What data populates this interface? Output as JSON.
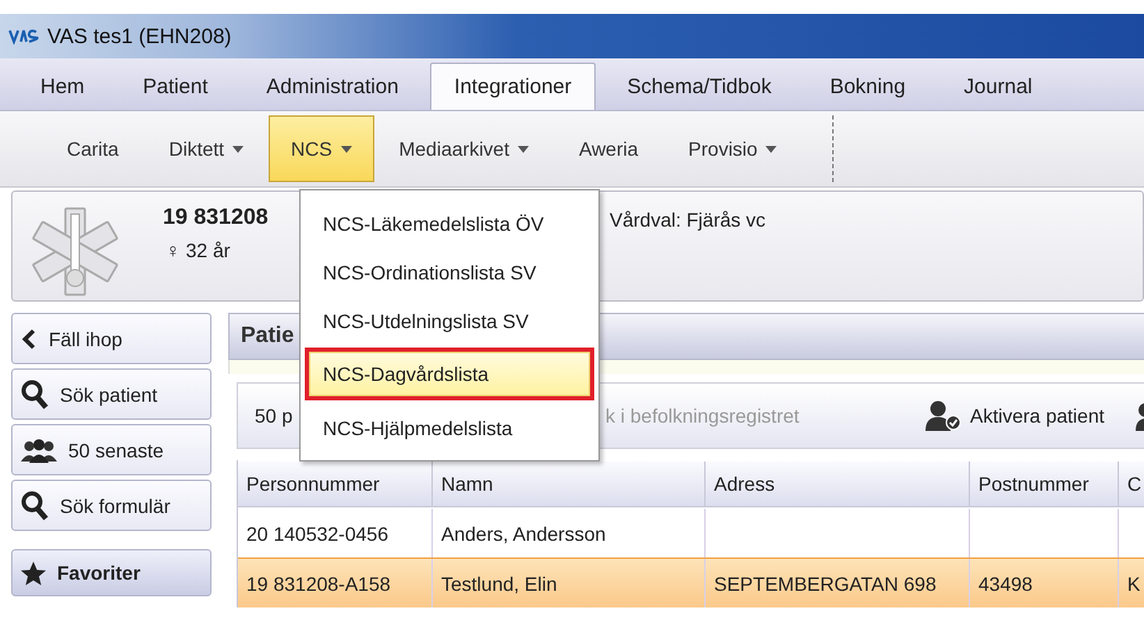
{
  "window": {
    "title": "VAS tes1 (EHN208)"
  },
  "tabs": [
    {
      "label": "Hem",
      "selected": false
    },
    {
      "label": "Patient",
      "selected": false
    },
    {
      "label": "Administration",
      "selected": false
    },
    {
      "label": "Integrationer",
      "selected": true
    },
    {
      "label": "Schema/Tidbok",
      "selected": false
    },
    {
      "label": "Bokning",
      "selected": false
    },
    {
      "label": "Journal",
      "selected": false
    }
  ],
  "ribbon": [
    {
      "label": "Carita",
      "dropdown": false,
      "selected": false
    },
    {
      "label": "Diktett",
      "dropdown": true,
      "selected": false
    },
    {
      "label": "NCS",
      "dropdown": true,
      "selected": true
    },
    {
      "label": "Mediaarkivet",
      "dropdown": true,
      "selected": false
    },
    {
      "label": "Aweria",
      "dropdown": false,
      "selected": false
    },
    {
      "label": "Provisio",
      "dropdown": true,
      "selected": false
    }
  ],
  "patient": {
    "id": "19 831208",
    "sex_symbol": "♀",
    "age": "32 år",
    "vardval": "Vårdval: Fjärås vc"
  },
  "sidebar": [
    {
      "label": "Fäll ihop",
      "kind": "collapse"
    },
    {
      "label": "Sök patient",
      "kind": "search"
    },
    {
      "label": "50 senaste",
      "kind": "people"
    },
    {
      "label": "Sök formulär",
      "kind": "search"
    },
    {
      "label": "Favoriter",
      "kind": "section"
    }
  ],
  "panel": {
    "title": "Patie",
    "toolbar": {
      "count": "50 p",
      "register_search": "k i befolkningsregistret",
      "action": "Aktivera patient"
    }
  },
  "table": {
    "columns": [
      "Personnummer",
      "Namn",
      "Adress",
      "Postnummer",
      "C"
    ],
    "rows": [
      {
        "cells": [
          "20 140532-0456",
          "Anders, Andersson",
          "",
          "",
          ""
        ],
        "selected": false
      },
      {
        "cells": [
          "19 831208-A158",
          "Testlund, Elin",
          "SEPTEMBERGATAN 698",
          "43498",
          "K"
        ],
        "selected": true
      }
    ]
  },
  "menu": {
    "items": [
      {
        "label": "NCS-Läkemedelslista ÖV",
        "selected": false
      },
      {
        "label": "NCS-Ordinationslista SV",
        "selected": false
      },
      {
        "label": "NCS-Utdelningslista SV",
        "selected": false
      },
      {
        "label": "NCS-Dagvårdslista",
        "selected": true
      },
      {
        "label": "NCS-Hjälpmedelslista",
        "selected": false
      }
    ]
  }
}
